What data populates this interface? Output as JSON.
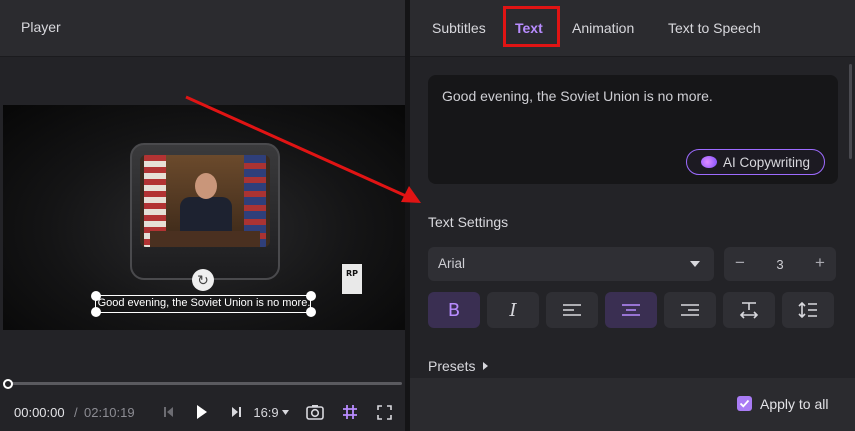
{
  "player": {
    "title": "Player",
    "subtitle_text": "Good evening, the Soviet Union is no more.",
    "rating_badge": "RP",
    "current_time": "00:00:00",
    "time_separator": "/",
    "total_time": "02:10:19",
    "aspect_ratio": "16:9",
    "playhead_position": 0
  },
  "panel": {
    "tabs": [
      {
        "label": "Subtitles"
      },
      {
        "label": "Text"
      },
      {
        "label": "Animation"
      },
      {
        "label": "Text to Speech"
      }
    ],
    "active_tab": "Text",
    "text_value": "Good evening, the Soviet Union is no more.",
    "ai_button_label": "AI Copywriting",
    "settings_title": "Text Settings",
    "font": "Arial",
    "font_size": "3",
    "format_buttons": [
      {
        "label": "B",
        "icon": "bold-icon",
        "active": true
      },
      {
        "label": "I",
        "icon": "italic-icon",
        "active": false
      },
      {
        "icon": "align-left-icon",
        "active": false
      },
      {
        "icon": "align-center-icon",
        "active": true
      },
      {
        "icon": "align-right-icon",
        "active": false
      },
      {
        "icon": "letter-spacing-icon",
        "active": false
      },
      {
        "icon": "line-height-icon",
        "active": false
      }
    ],
    "presets_label": "Presets",
    "apply_all_label": "Apply to all",
    "apply_all_checked": true
  },
  "colors": {
    "accent": "#b88cff",
    "highlight": "#e01414",
    "annotation_arrow": "#e01414"
  }
}
